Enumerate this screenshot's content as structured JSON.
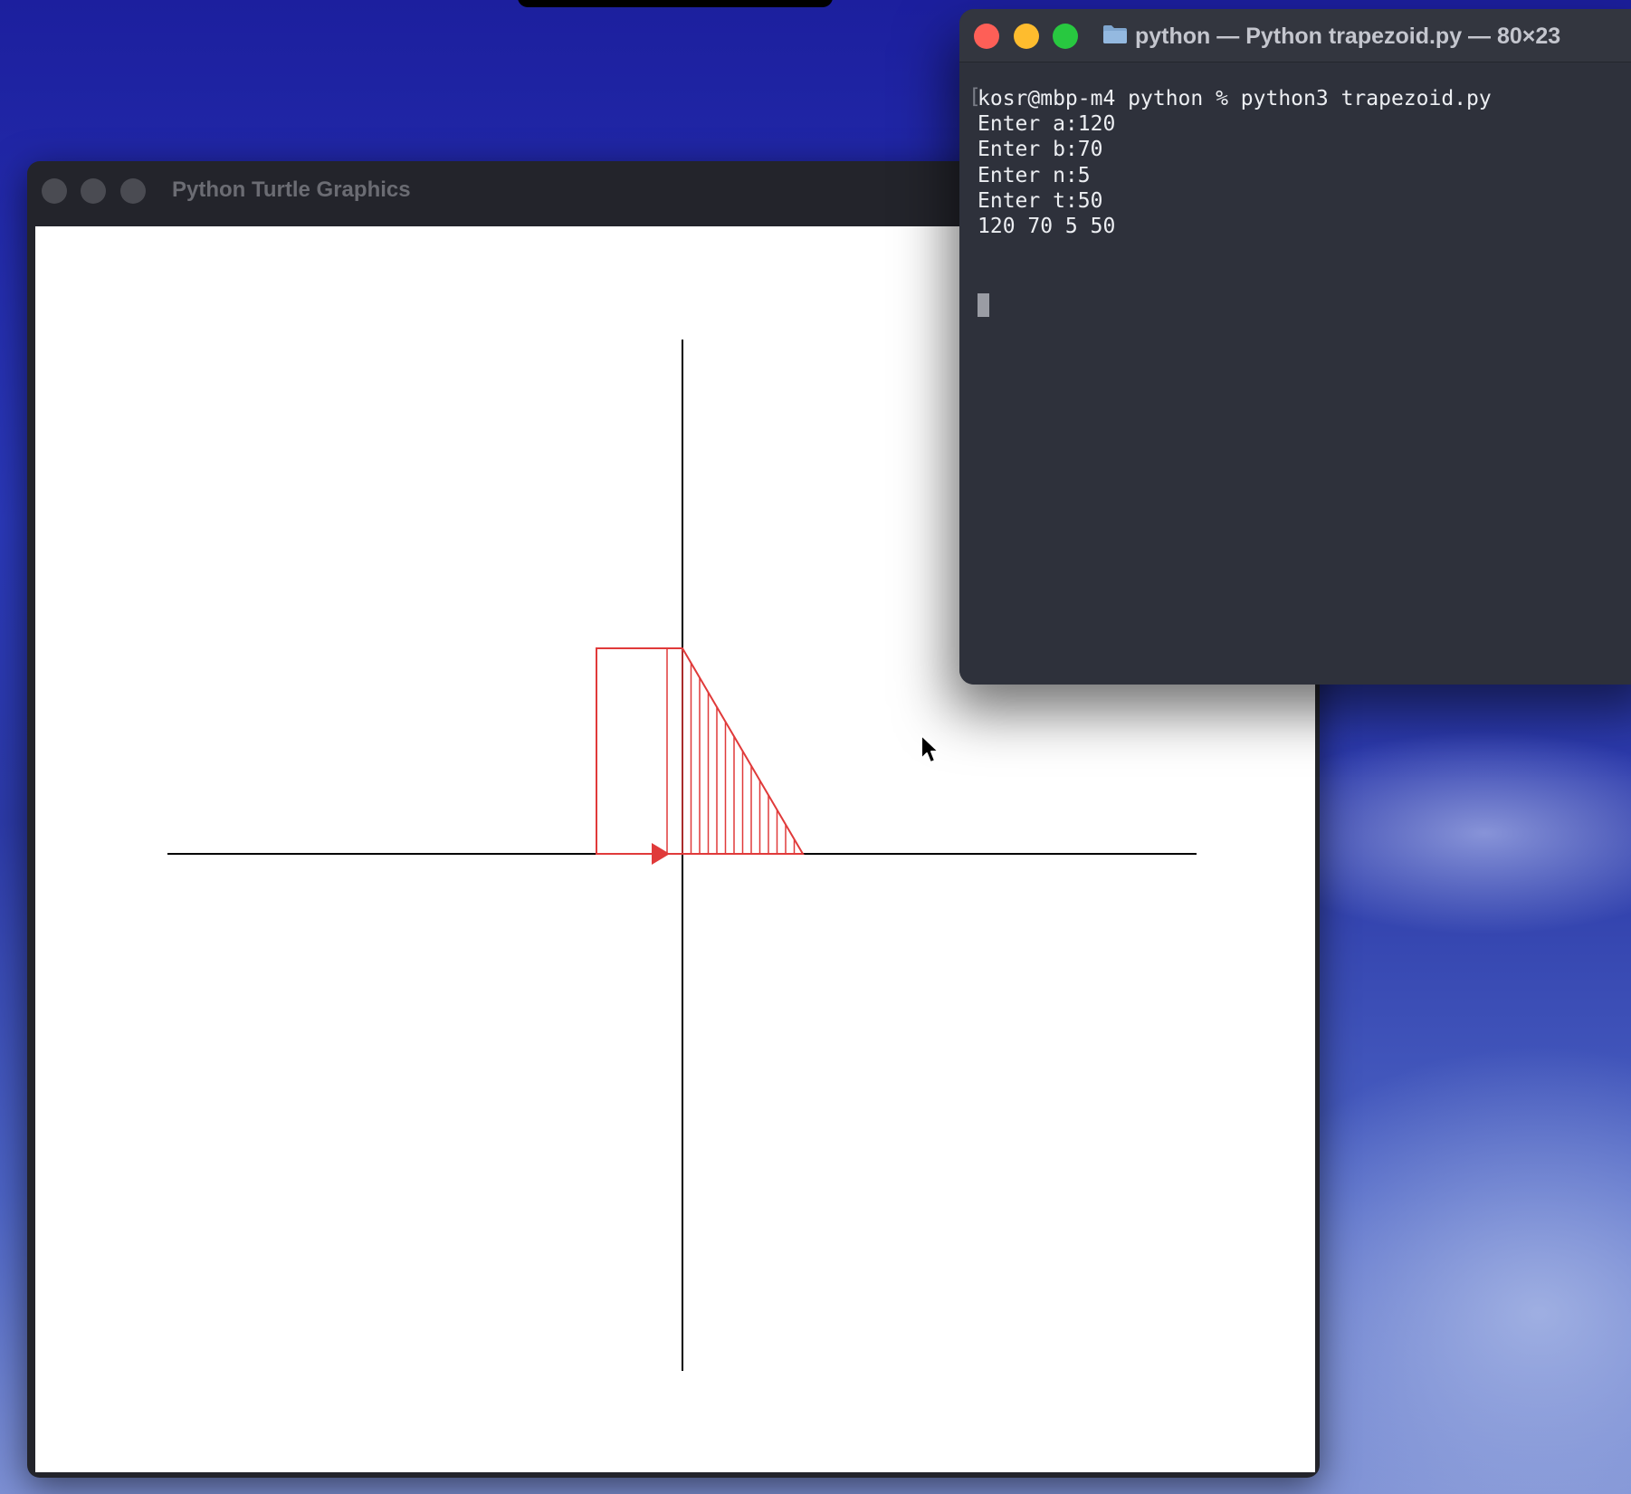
{
  "turtle_window": {
    "title": "Python Turtle Graphics",
    "pen_color": "#e03a3a",
    "axis_color": "#000000"
  },
  "terminal": {
    "title": "python — Python trapezoid.py — 80×23",
    "lines": [
      "kosr@mbp-m4 python % python3 trapezoid.py",
      "Enter a:120",
      "Enter b:70",
      "Enter n:5",
      "Enter t:50",
      "120 70 5 50"
    ],
    "prompt_bracket": "["
  },
  "icons": {
    "folder": "folder-icon",
    "mouse": "mouse-pointer-icon",
    "turtle": "turtle-arrow-icon"
  }
}
